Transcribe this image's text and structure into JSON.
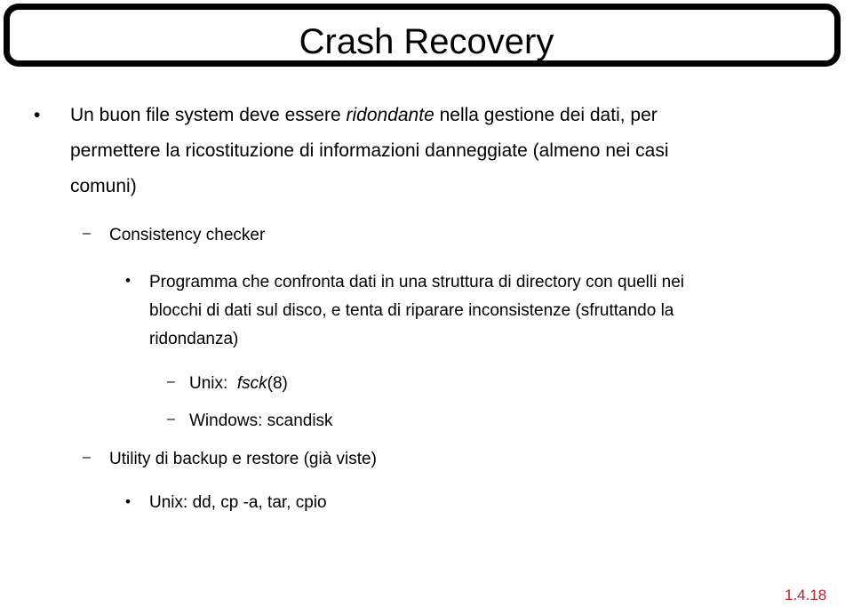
{
  "slide": {
    "title": "Crash Recovery",
    "page_number": "1.4.18",
    "page_number_color": "#c0202a",
    "markers": {
      "bullet": "•",
      "dash": "–"
    },
    "bullet1": {
      "line1_before": "Un buon file system deve essere ",
      "line1_italic": "ridondante",
      "line1_after": " nella gestione dei dati, per",
      "line2": "permettere la ricostituzione di informazioni danneggiate (almeno nei casi",
      "line3": "comuni)"
    },
    "sub1": {
      "label": "Consistency checker",
      "item": {
        "line1": "Programma che confronta dati in una struttura di directory con quelli nei",
        "line2": "blocchi di dati sul disco, e tenta di riparare inconsistenze (sfruttando la",
        "line3": "ridondanza)"
      },
      "examples": [
        {
          "prefix": "Unix:  ",
          "italic": "fsck",
          "suffix": "(8)"
        },
        {
          "prefix": "Windows: scandisk",
          "italic": "",
          "suffix": ""
        }
      ]
    },
    "sub2": {
      "label": "Utility di backup e restore (già viste)",
      "item": "Unix: dd, cp -a, tar, cpio"
    }
  }
}
